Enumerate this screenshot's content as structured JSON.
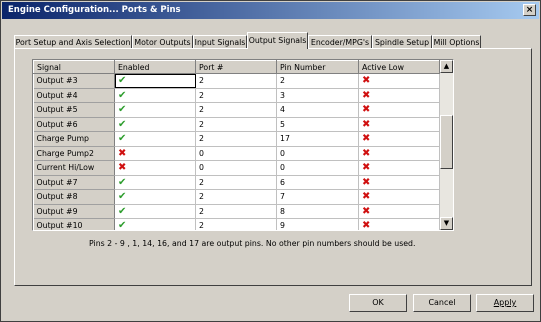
{
  "window": {
    "title": "Engine Configuration... Ports & Pins",
    "close_label": "×"
  },
  "tabs": [
    {
      "label": "Port Setup and Axis Selection"
    },
    {
      "label": "Motor Outputs"
    },
    {
      "label": "Input Signals"
    },
    {
      "label": "Output Signals"
    },
    {
      "label": "Encoder/MPG's"
    },
    {
      "label": "Spindle Setup"
    },
    {
      "label": "Mill Options"
    }
  ],
  "table": {
    "headers": [
      "Signal",
      "Enabled",
      "Port #",
      "Pin Number",
      "Active Low"
    ],
    "rows": [
      {
        "signal": "Output #3",
        "enabled": true,
        "port": "2",
        "pin": "2",
        "active_low": "x"
      },
      {
        "signal": "Output #4",
        "enabled": true,
        "port": "2",
        "pin": "3",
        "active_low": "x"
      },
      {
        "signal": "Output #5",
        "enabled": true,
        "port": "2",
        "pin": "4",
        "active_low": "x"
      },
      {
        "signal": "Output #6",
        "enabled": true,
        "port": "2",
        "pin": "5",
        "active_low": "x"
      },
      {
        "signal": "Charge Pump",
        "enabled": true,
        "port": "2",
        "pin": "17",
        "active_low": "x"
      },
      {
        "signal": "Charge Pump2",
        "enabled": false,
        "port": "0",
        "pin": "0",
        "active_low": "x"
      },
      {
        "signal": "Current Hi/Low",
        "enabled": false,
        "port": "0",
        "pin": "0",
        "active_low": "x"
      },
      {
        "signal": "Output #7",
        "enabled": true,
        "port": "2",
        "pin": "6",
        "active_low": "x"
      },
      {
        "signal": "Output #8",
        "enabled": true,
        "port": "2",
        "pin": "7",
        "active_low": "x"
      },
      {
        "signal": "Output #9",
        "enabled": true,
        "port": "2",
        "pin": "8",
        "active_low": "x"
      },
      {
        "signal": "Output #10",
        "enabled": true,
        "port": "2",
        "pin": "9",
        "active_low": "x"
      }
    ]
  },
  "icons": {
    "check": "check-icon",
    "cross": "cross-icon",
    "check_color": "#2e9e2e",
    "cross_color": "#d01010"
  },
  "note": "Pins 2 - 9 , 1, 14, 16, and 17 are output pins.  No  other pin numbers should be used.",
  "buttons": {
    "ok": "OK",
    "cancel": "Cancel",
    "apply": "Apply"
  }
}
